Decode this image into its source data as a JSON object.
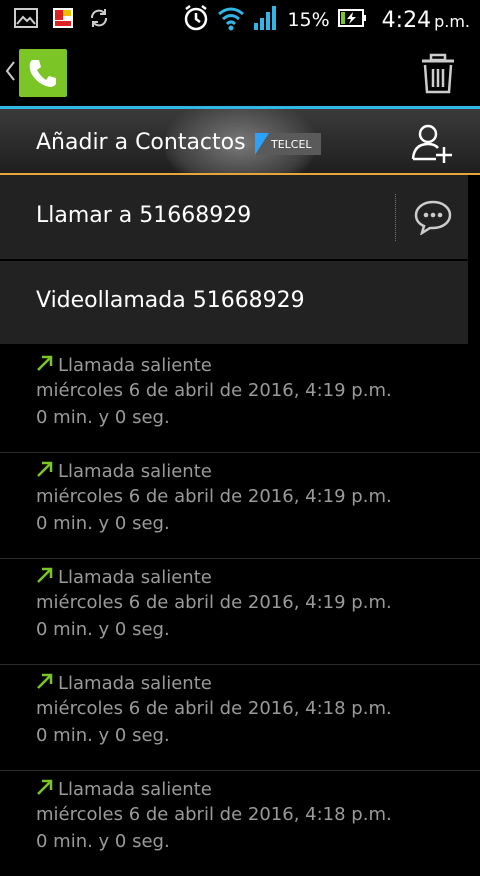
{
  "status_bar": {
    "icons": [
      "gallery-icon",
      "store-icon",
      "sync-icon",
      "alarm-icon",
      "wifi-icon",
      "signal-icon",
      "battery-charging-icon"
    ],
    "battery_percent": "15%",
    "time": "4:24",
    "ampm": "p.m."
  },
  "action_bar": {
    "app_icon": "phone-icon",
    "delete_icon": "trash-icon"
  },
  "contact_header": {
    "add_contact_label": "Añadir a Contactos",
    "carrier_badge": "TELCEL"
  },
  "actions": {
    "call_label": "Llamar a 51668929",
    "video_label": "Videollamada 51668929"
  },
  "call_log": [
    {
      "type": "Llamada saliente",
      "date": "miércoles 6 de abril de 2016, 4:19 p.m.",
      "duration": "0 min. y 0 seg."
    },
    {
      "type": "Llamada saliente",
      "date": "miércoles 6 de abril de 2016, 4:19 p.m.",
      "duration": "0 min. y 0 seg."
    },
    {
      "type": "Llamada saliente",
      "date": "miércoles 6 de abril de 2016, 4:19 p.m.",
      "duration": "0 min. y 0 seg."
    },
    {
      "type": "Llamada saliente",
      "date": "miércoles 6 de abril de 2016, 4:18 p.m.",
      "duration": "0 min. y 0 seg."
    },
    {
      "type": "Llamada saliente",
      "date": "miércoles 6 de abril de 2016, 4:18 p.m.",
      "duration": "0 min. y 0 seg."
    }
  ],
  "colors": {
    "accent_blue": "#33b5e5",
    "accent_orange": "#e8a63a",
    "outgoing_green": "#7bc526"
  }
}
